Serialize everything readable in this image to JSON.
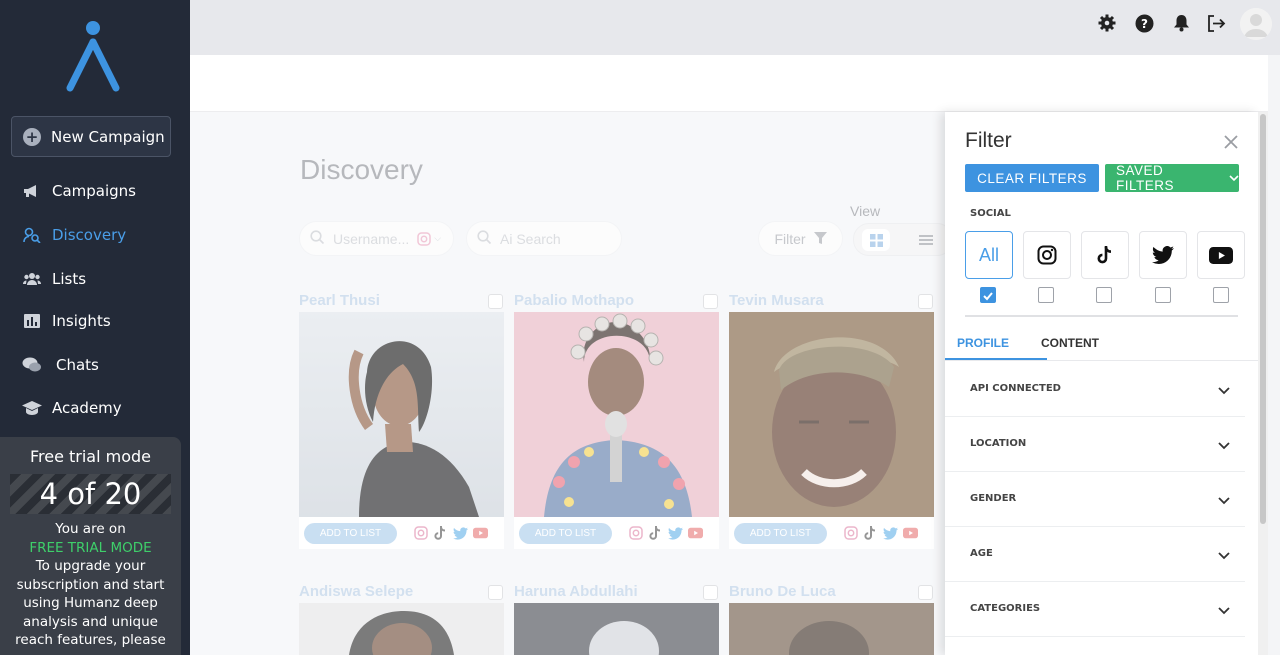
{
  "sidebar": {
    "new_campaign_label": "New Campaign",
    "items": [
      {
        "label": "Campaigns",
        "icon": "megaphone-icon"
      },
      {
        "label": "Discovery",
        "icon": "discovery-icon"
      },
      {
        "label": "Lists",
        "icon": "users-icon"
      },
      {
        "label": "Insights",
        "icon": "chart-icon"
      },
      {
        "label": "Chats",
        "icon": "chat-icon"
      },
      {
        "label": "Academy",
        "icon": "graduation-cap-icon"
      }
    ],
    "trial": {
      "title": "Free trial mode",
      "count": "4 of 20",
      "line1": "You are on",
      "mode": "FREE TRIAL MODE",
      "body": "To upgrade your subscription and start using Humanz deep analysis and unique reach features, please"
    }
  },
  "topbar": {
    "icons": [
      "gear-icon",
      "help-icon",
      "bell-icon",
      "logout-icon"
    ]
  },
  "main": {
    "title": "Discovery",
    "search_username_placeholder": "Username...",
    "search_ai_placeholder": "Ai Search",
    "filter_label": "Filter",
    "view_label": "View",
    "add_to_list_label": "ADD TO LIST",
    "cards": [
      {
        "name": "Pearl Thusi"
      },
      {
        "name": "Pabalio Mothapo"
      },
      {
        "name": "Tevin Musara"
      },
      {
        "name": "Andiswa Selepe"
      },
      {
        "name": "Haruna Abdullahi"
      },
      {
        "name": "Bruno De Luca"
      }
    ]
  },
  "filter_panel": {
    "title": "Filter",
    "clear_label": "CLEAR FILTERS",
    "saved_label": "SAVED FILTERS",
    "social_label": "SOCIAL",
    "social_all": "All",
    "social_networks": [
      "instagram-icon",
      "tiktok-icon",
      "twitter-icon",
      "youtube-icon"
    ],
    "tabs": [
      "PROFILE",
      "CONTENT"
    ],
    "sections": [
      "API CONNECTED",
      "LOCATION",
      "GENDER",
      "AGE",
      "CATEGORIES"
    ]
  },
  "colors": {
    "sidebar_bg": "#232a38",
    "accent_blue": "#3d93e0",
    "accent_green": "#3ab56f",
    "trial_green": "#3ecf6a"
  }
}
